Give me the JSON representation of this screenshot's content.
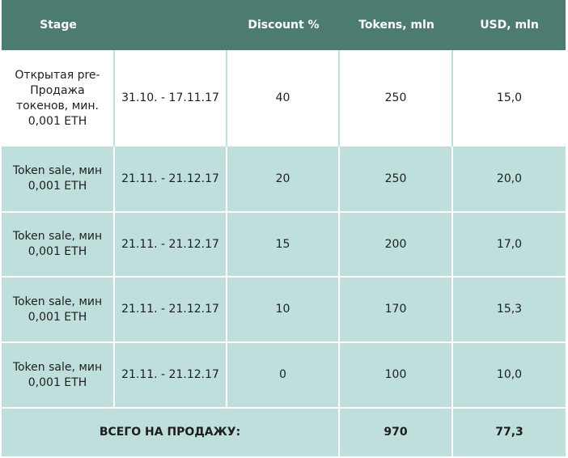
{
  "header": {
    "stage": "Stage",
    "dates": "",
    "discount": "Discount %",
    "tokens": "Tokens, mln",
    "usd": "USD, mln"
  },
  "rows": [
    {
      "stage": "Открытая pre-Продажа токенов, мин. 0,001 ETH",
      "dates": "31.10. - 17.11.17",
      "discount": "40",
      "tokens": "250",
      "usd": "15,0"
    },
    {
      "stage": "Token sale, мин 0,001 ETH",
      "dates": "21.11. - 21.12.17",
      "discount": "20",
      "tokens": "250",
      "usd": "20,0"
    },
    {
      "stage": "Token sale, мин 0,001 ETH",
      "dates": "21.11. - 21.12.17",
      "discount": "15",
      "tokens": "200",
      "usd": "17,0"
    },
    {
      "stage": "Token sale, мин 0,001 ETH",
      "dates": "21.11. - 21.12.17",
      "discount": "10",
      "tokens": "170",
      "usd": "15,3"
    },
    {
      "stage": "Token sale, мин 0,001 ETH",
      "dates": "21.11. - 21.12.17",
      "discount": "0",
      "tokens": "100",
      "usd": "10,0"
    }
  ],
  "total": {
    "label": "ВСЕГО НА ПРОДАЖУ:",
    "tokens": "970",
    "usd": "77,3"
  },
  "colors": {
    "header_bg": "#4c7c71",
    "row_bg": "#bfdfdc",
    "first_row_bg": "#ffffff"
  }
}
